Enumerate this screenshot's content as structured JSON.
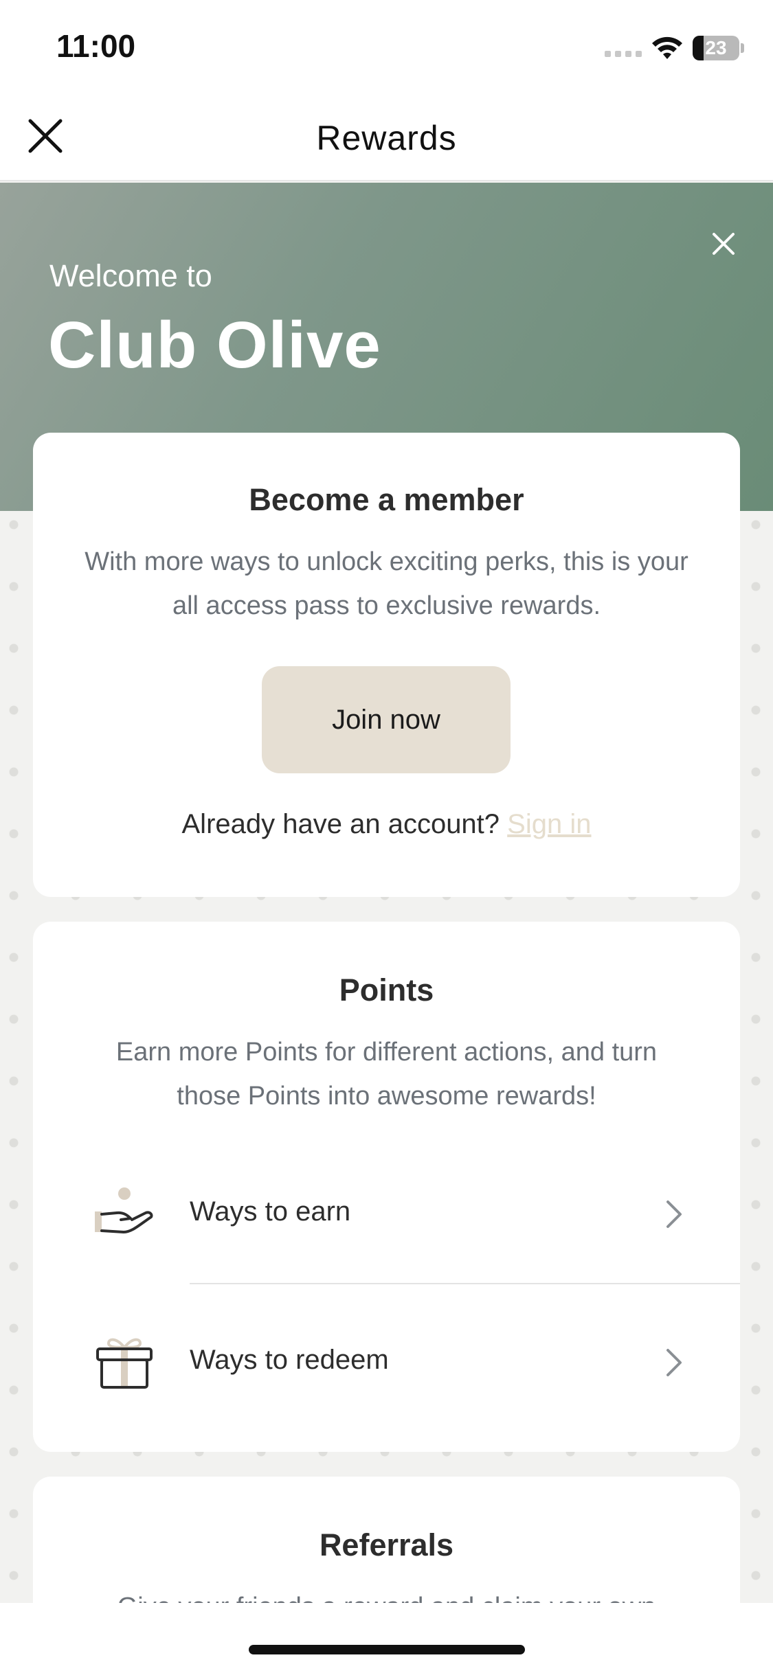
{
  "status_bar": {
    "time": "11:00",
    "battery_level": "23"
  },
  "header": {
    "title": "Rewards",
    "close_icon": "close-icon"
  },
  "hero": {
    "pre_title": "Welcome to",
    "title": "Club Olive",
    "dismiss_icon": "close-icon",
    "gradient_colors": [
      "#98a39b",
      "#6a8c77"
    ]
  },
  "member_card": {
    "title": "Become a member",
    "description": "With more ways to unlock exciting perks, this is your all access pass to exclusive rewards.",
    "join_button_label": "Join now",
    "signin_prompt": "Already have an account?",
    "signin_link": "Sign in"
  },
  "points_card": {
    "title": "Points",
    "description": "Earn more Points for different actions, and turn those Points into awesome rewards!",
    "items": [
      {
        "label": "Ways to earn",
        "icon": "hand-coin-icon"
      },
      {
        "label": "Ways to redeem",
        "icon": "gift-icon"
      }
    ]
  },
  "referrals_card": {
    "title": "Referrals",
    "description": "Give your friends a reward and claim your own"
  },
  "colors": {
    "accent_beige": "#e6dfd3",
    "link_beige": "#e5ddcd",
    "hero_green": "#6a8c77"
  }
}
